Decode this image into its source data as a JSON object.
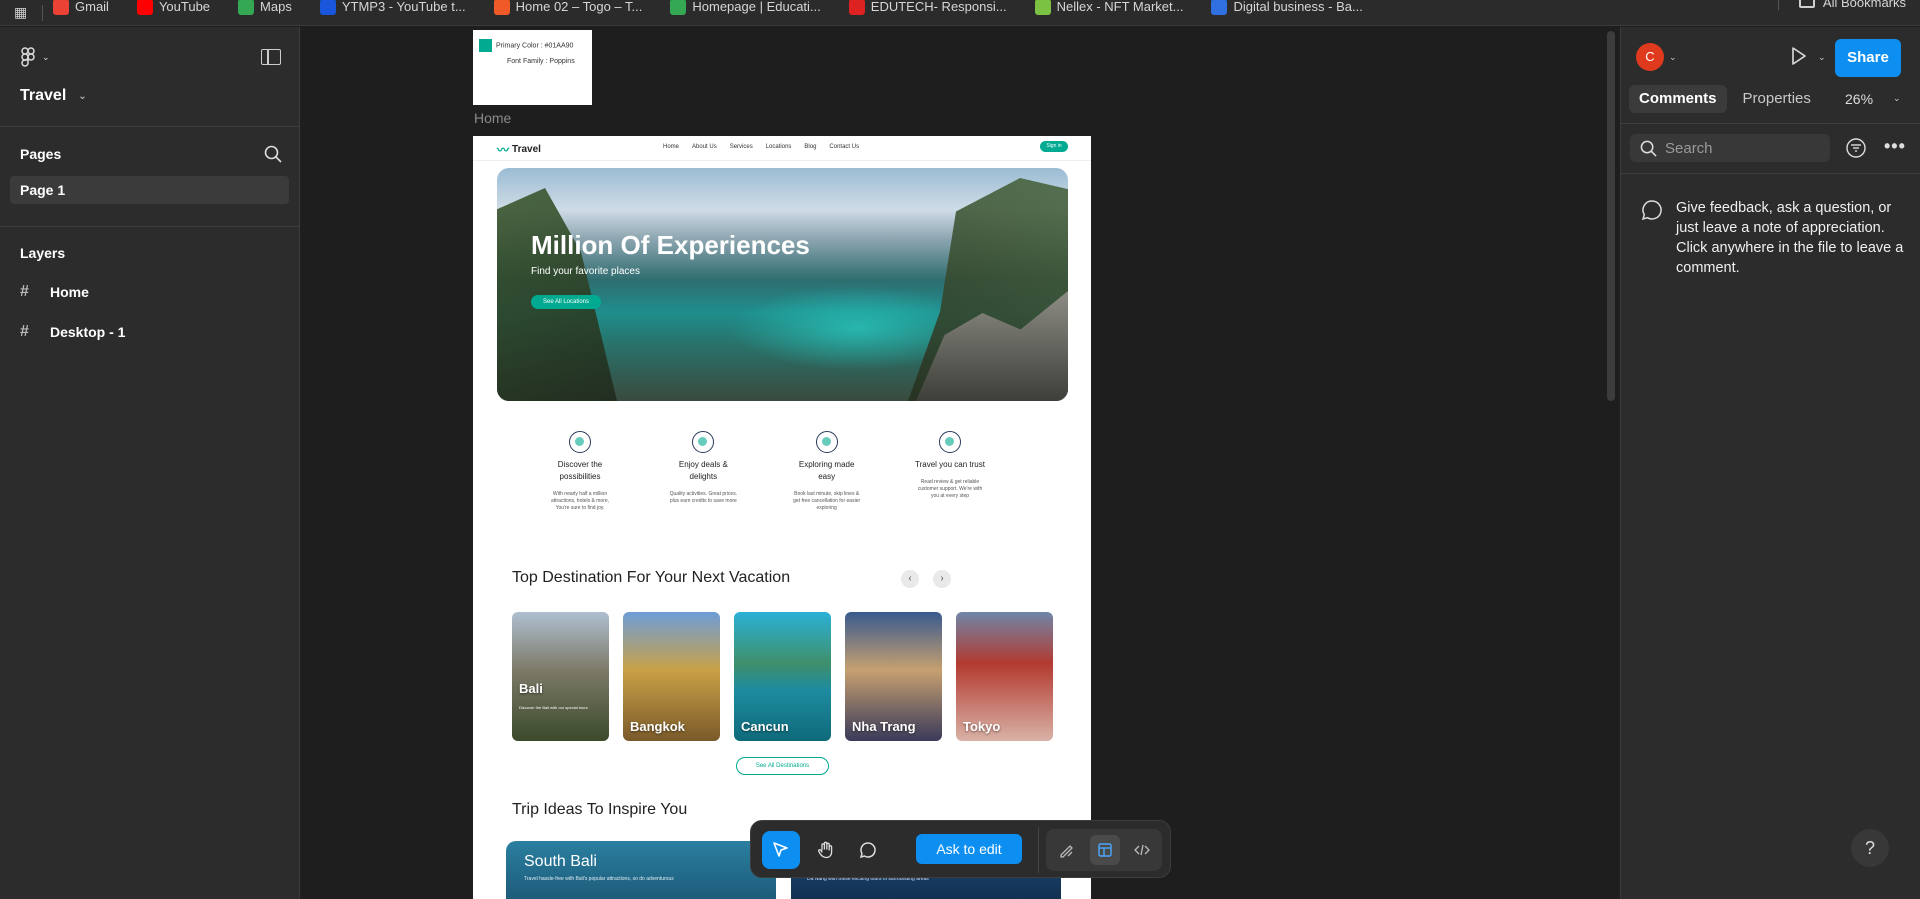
{
  "bookmarks": {
    "items": [
      {
        "label": "Gmail",
        "color": "#ea4335"
      },
      {
        "label": "YouTube",
        "color": "#ff0000"
      },
      {
        "label": "Maps",
        "color": "#34a853"
      },
      {
        "label": "YTMP3 - YouTube t...",
        "color": "#1a56db"
      },
      {
        "label": "Home 02 – Togo – T...",
        "color": "#f05a28"
      },
      {
        "label": "Homepage | Educati...",
        "color": "#34a853"
      },
      {
        "label": "EDUTECH- Responsi...",
        "color": "#d22"
      },
      {
        "label": "Nellex - NFT Market...",
        "color": "#7bc142"
      },
      {
        "label": "Digital business - Ba...",
        "color": "#2f6fe0"
      }
    ],
    "all_label": "All Bookmarks"
  },
  "left": {
    "file_name": "Travel",
    "pages_title": "Pages",
    "page_item": "Page 1",
    "layers_title": "Layers",
    "layers": [
      "Home",
      "Desktop - 1"
    ]
  },
  "canvas": {
    "style_card": {
      "primary": "Primary Color : #01AA90",
      "font": "Font Family : Poppins",
      "swatch": "#01AA90"
    },
    "frame_label": "Home",
    "site": {
      "logo": "Travel",
      "nav": [
        "Home",
        "About Us",
        "Services",
        "Locations",
        "Blog",
        "Contact Us"
      ],
      "sign_in": "Sign in",
      "hero_title": "Million Of Experiences",
      "hero_sub": "Find your favorite places",
      "hero_cta": "See All Locations",
      "features": [
        {
          "title": "Discover the possibilities",
          "desc": "With nearly half a million attractions, hotels & more, You're sure to find joy."
        },
        {
          "title": "Enjoy deals & delights",
          "desc": "Quality activities. Great prices. plus earn credits to save more"
        },
        {
          "title": "Exploring made easy",
          "desc": "Book last minute, skip lines & get free cancellation for easier exploring"
        },
        {
          "title": "Travel you can trust",
          "desc": "Read review & get reliable customer support. We're with you at every step"
        }
      ],
      "dest_title": "Top Destination For Your Next Vacation",
      "prev": "‹",
      "next": "›",
      "cards": [
        "Bali",
        "Bangkok",
        "Cancun",
        "Nha Trang",
        "Tokyo"
      ],
      "bali_sub": "Discover the Bali with our special tours",
      "see_dest": "See All Destinations",
      "trip_title": "Trip Ideas To Inspire You",
      "trip1_title": "South Bali",
      "trip1_desc": "Travel hassle-free with Bali's popular attractions, so do adventurous",
      "trip2_desc": "Da Nang with these exciting tours of surrounding areas"
    }
  },
  "toolbar": {
    "ask_edit": "Ask to edit"
  },
  "right": {
    "avatar": "C",
    "share": "Share",
    "tabs": [
      "Comments",
      "Properties"
    ],
    "zoom": "26%",
    "search_placeholder": "Search",
    "hint": "Give feedback, ask a question, or just leave a note of appreciation. Click anywhere in the file to leave a comment.",
    "help": "?"
  }
}
